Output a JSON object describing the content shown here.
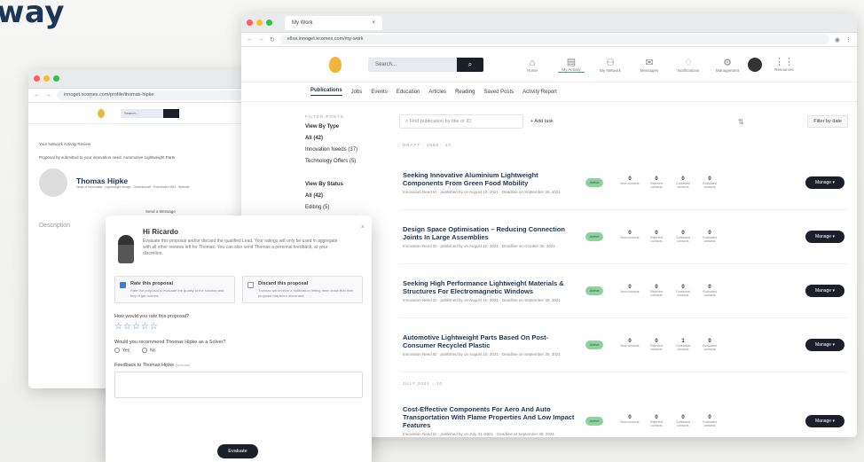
{
  "headline": "way",
  "main_window": {
    "tab_title": "My Work",
    "url": "ellsa.innoget.xcomes.com/my-work",
    "search_placeholder": "Search...",
    "nav": [
      {
        "icon": "home-icon",
        "label": "Home"
      },
      {
        "icon": "briefcase-icon",
        "label": "My Activity",
        "active": true
      },
      {
        "icon": "network-icon",
        "label": "My Network"
      },
      {
        "icon": "messages-icon",
        "label": "Messages"
      },
      {
        "icon": "bell-icon",
        "label": "Notifications"
      },
      {
        "icon": "gear-icon",
        "label": "Management"
      }
    ],
    "extra_nav_label": "Resources",
    "subnav": [
      "Publications",
      "Jobs",
      "Events",
      "Education",
      "Articles",
      "Reading",
      "Saved Posts",
      "Activity Report"
    ],
    "active_subnav": "Publications",
    "sidebar": {
      "heading": "FILTER POSTS",
      "groups": [
        [
          "View By Type",
          "All (42)",
          "Innovation Needs (37)",
          "Technology Offers (5)"
        ],
        [
          "View By Status",
          "All (42)",
          "Editing (5)"
        ]
      ]
    },
    "find_placeholder": "Find publication by title or ID",
    "add_task": "+ Add task",
    "filter_label": "Filter by date",
    "section_1": "DRAFT · 1998 · 10",
    "section_2": "JULY 2021 · 10",
    "stat_labels": [
      "New contacts",
      "Rejected contacts",
      "Contacted contacts",
      "Evaluated contacts"
    ],
    "status_label": "Active",
    "manage_label": "Manage",
    "rows": [
      {
        "title": "Seeking Innovative Aluminium Lightweight Components From Green Food Mobility",
        "meta": "Innovation Need ID · published by on August 10, 2021 · Deadline on September 30, 2021",
        "stats": [
          "0",
          "0",
          "0",
          "0"
        ]
      },
      {
        "title": "Design Space Optimisation – Reducing Connection Joints In Large Assemblies",
        "meta": "Innovation Need ID · published by on August 10, 2021 · Deadline on October 30, 2021",
        "stats": [
          "0",
          "0",
          "0",
          "0"
        ]
      },
      {
        "title": "Seeking High Performance Lightweight Materials & Structures For Electromagnetic Windows",
        "meta": "Innovation Need ID · published by on August 10, 2021 · Deadline on September 30, 2021",
        "stats": [
          "0",
          "0",
          "0",
          "0"
        ]
      },
      {
        "title": "Automotive Lightweight Parts Based On Post-Consumer Recycled Plastic",
        "meta": "Innovation Need ID · published by on August 10, 2021 · Deadline on September 30, 2021",
        "stats": [
          "0",
          "0",
          "1",
          "0"
        ]
      },
      {
        "title": "Cost-Effective Components For Aero And Auto Transportation With Flame Properties And Low Impact Features",
        "meta": "Innovation Need ID · published by on July 31, 2021 · Deadline at September 30, 2021",
        "stats": [
          "0",
          "0",
          "0",
          "0"
        ]
      }
    ]
  },
  "left_window": {
    "url": "innoget.xcomes.com/profile/thomas-hipke",
    "search_placeholder": "Search...",
    "line1": "Your Network Activity Review",
    "line2": "Proposal by submitted to your innovation need: Automotive Lightweight Parts",
    "name": "Thomas Hipke",
    "details": "Head of Innovation · Lightweight design · Gesellschaft · Fraunhofer IWU · Website",
    "side_text": "Send a Message",
    "desc_label": "Description"
  },
  "modal": {
    "title": "Hi Ricardo",
    "description": "Evaluate this proposal and/or discard the qualified Lead. Your ratings will only be used in aggregate with all other reviews left for Thomas. You can also send Thomas a personal feedback, at your discretion.",
    "option_rate_title": "Rate this proposal",
    "option_rate_desc": "Rate the proposal to evaluate the quality of the solution and help it get noticed.",
    "option_discard_title": "Discard this proposal",
    "option_discard_desc": "Thomas will receive a notification letting them know that their proposal has been discarded.",
    "rate_question": "How would you rate this proposal?",
    "stars": "☆☆☆☆☆",
    "recommend_question": "Would you recommend Thomas Hipke as a Solver?",
    "yes": "Yes",
    "no": "No",
    "feedback_label": "Feedback to Thomas Hipke",
    "feedback_optional": "(optional)",
    "evaluate_button": "Evaluate"
  },
  "colors": {
    "brand": "#1d3557",
    "accent": "#f0b53d",
    "dark_button": "#1b1f29",
    "active_status": "#8fd19e",
    "star": "#3d7edb"
  }
}
